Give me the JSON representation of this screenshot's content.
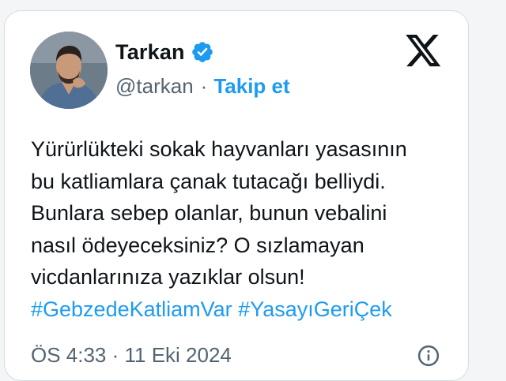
{
  "author": {
    "display_name": "Tarkan",
    "handle": "@tarkan",
    "separator": "·",
    "follow_label": "Takip et",
    "verified": true
  },
  "tweet": {
    "lines": [
      "Yürürlükteki sokak hayvanları yasasının",
      "bu katliamlara çanak tutacağı belliydi.",
      "Bunlara sebep olanlar, bunun vebalini",
      "nasıl ödeyeceksiniz? O sızlamayan",
      "vicdanlarınıza yazıklar olsun!"
    ],
    "hashtags": [
      "#GebzedeKatliamVar",
      "#YasayıGeriÇek"
    ],
    "timestamp": "ÖS 4:33 · 11 Eki 2024"
  },
  "icons": {
    "brand": "x-logo-icon",
    "verified": "verified-badge-icon",
    "info": "info-icon"
  },
  "colors": {
    "accent": "#1d9bf0",
    "text": "#0f1419",
    "secondary": "#536471",
    "border": "#d6dbe0"
  }
}
